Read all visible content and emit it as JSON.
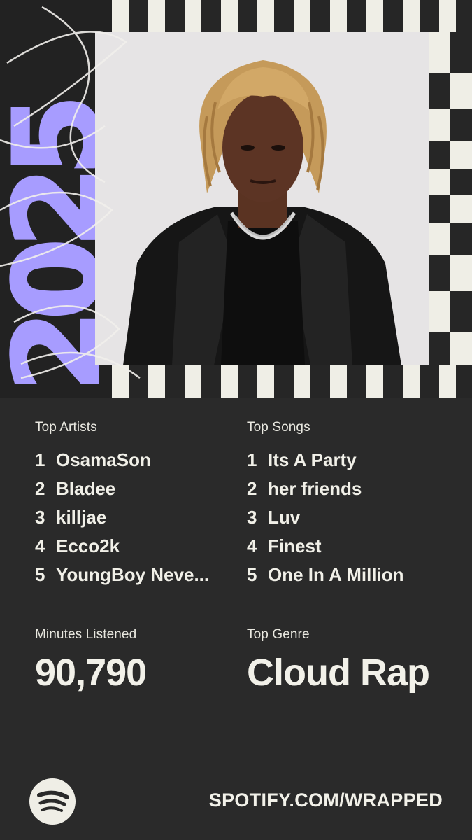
{
  "year_graphic": "2025",
  "top_artists": {
    "label": "Top Artists",
    "items": [
      {
        "rank": "1",
        "name": "OsamaSon"
      },
      {
        "rank": "2",
        "name": "Bladee"
      },
      {
        "rank": "3",
        "name": "killjae"
      },
      {
        "rank": "4",
        "name": "Ecco2k"
      },
      {
        "rank": "5",
        "name": "YoungBoy Neve..."
      }
    ]
  },
  "top_songs": {
    "label": "Top Songs",
    "items": [
      {
        "rank": "1",
        "name": "Its A Party"
      },
      {
        "rank": "2",
        "name": "her friends"
      },
      {
        "rank": "3",
        "name": "Luv"
      },
      {
        "rank": "4",
        "name": "Finest"
      },
      {
        "rank": "5",
        "name": "One In A Million"
      }
    ]
  },
  "minutes": {
    "label": "Minutes Listened",
    "value": "90,790"
  },
  "genre": {
    "label": "Top Genre",
    "value": "Cloud Rap"
  },
  "footer": {
    "logo_icon": "spotify-logo-icon",
    "link": "SPOTIFY.COM/WRAPPED"
  },
  "colors": {
    "background": "#2a2a2a",
    "accent": "#a79cff",
    "text": "#f1f0e8"
  }
}
